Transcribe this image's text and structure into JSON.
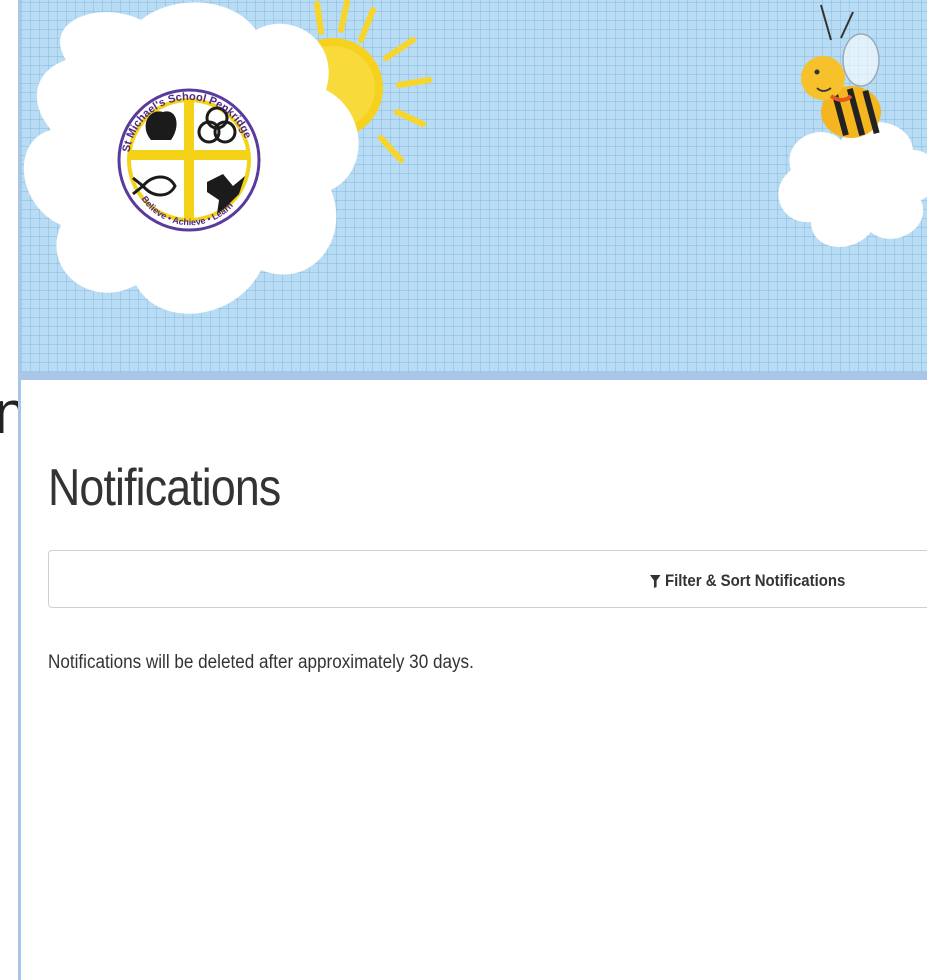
{
  "banner": {
    "school_logo": {
      "ring_text_top": "St Michael's School Penkridge",
      "ring_text_bottom": "Believe • Achieve • Learn",
      "colors": {
        "ring": "#f3d217",
        "ring_border": "#5a3a9c",
        "cross": "#f3d217",
        "text": "#4b2a8a"
      }
    },
    "background_color": "#b7dcf3",
    "decorations": [
      "sun",
      "flower-cloud",
      "bee",
      "small-cloud"
    ]
  },
  "page": {
    "title": "Notifications",
    "filter_button_label": "Filter & Sort Notifications",
    "filter_icon": "filter-icon",
    "info_text": "Notifications will be deleted after approximately 30 days."
  },
  "left_edge": {
    "visible_fragment": "n"
  }
}
